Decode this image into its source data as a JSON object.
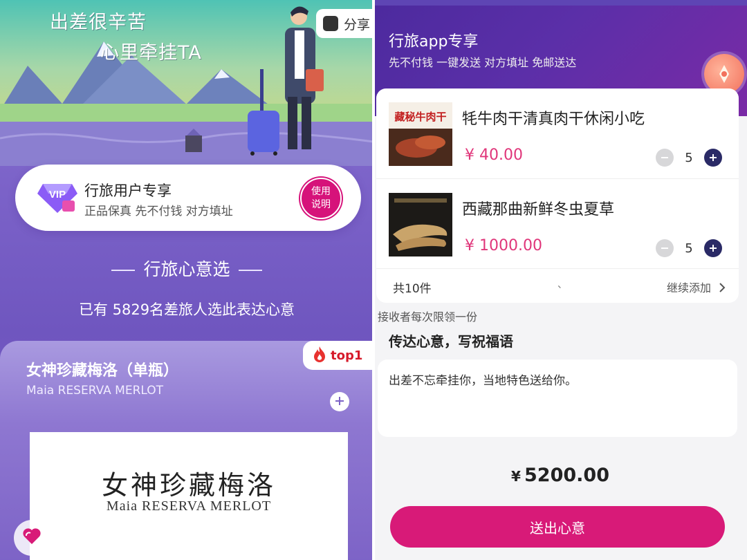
{
  "left": {
    "hero": {
      "slogan_line1": "出差很辛苦",
      "slogan_line2": "心里牵挂TA",
      "share_label": "分享"
    },
    "vip_card": {
      "badge_text": "VIP",
      "title": "行旅用户专享",
      "subtitle": "正品保真 先不付钱 对方填址",
      "help_line1": "使用",
      "help_line2": "说明"
    },
    "section": {
      "title": "行旅心意选",
      "count_text": "已有 5829名差旅人选此表达心意"
    },
    "product": {
      "badge": "top1",
      "name": "女神珍藏梅洛（单瓶）",
      "name_en": "Maia RESERVA MERLOT",
      "image_title": "女神珍藏梅洛",
      "image_subtitle": "Maia RESERVA MERLOT"
    }
  },
  "right": {
    "header": {
      "title": "行旅app专享",
      "subtitle": "先不付钱 一键发送 对方填址 免邮送达"
    },
    "cart": {
      "items": [
        {
          "name": "牦牛肉干清真肉干休闲小吃",
          "price": "¥ 40.00",
          "quantity": "5",
          "thumb_text": "藏秘牛肉干"
        },
        {
          "name": "西藏那曲新鲜冬虫夏草",
          "price": "¥ 1000.00",
          "quantity": "5"
        }
      ],
      "total_count": "共10件",
      "separator": "、",
      "continue_label": "继续添加"
    },
    "limit_note": "接收者每次限领一份",
    "message_title": "传达心意，写祝福语",
    "message_text": "出差不忘牵挂你，当地特色送给你。",
    "grand_total": {
      "symbol": "¥",
      "amount": "5200.00"
    },
    "send_label": "送出心意"
  },
  "colors": {
    "accent_pink": "#d81a78",
    "price_pink": "#e0367a",
    "header_purple": "#5b2fa8",
    "qty_plus": "#2a2a66"
  }
}
